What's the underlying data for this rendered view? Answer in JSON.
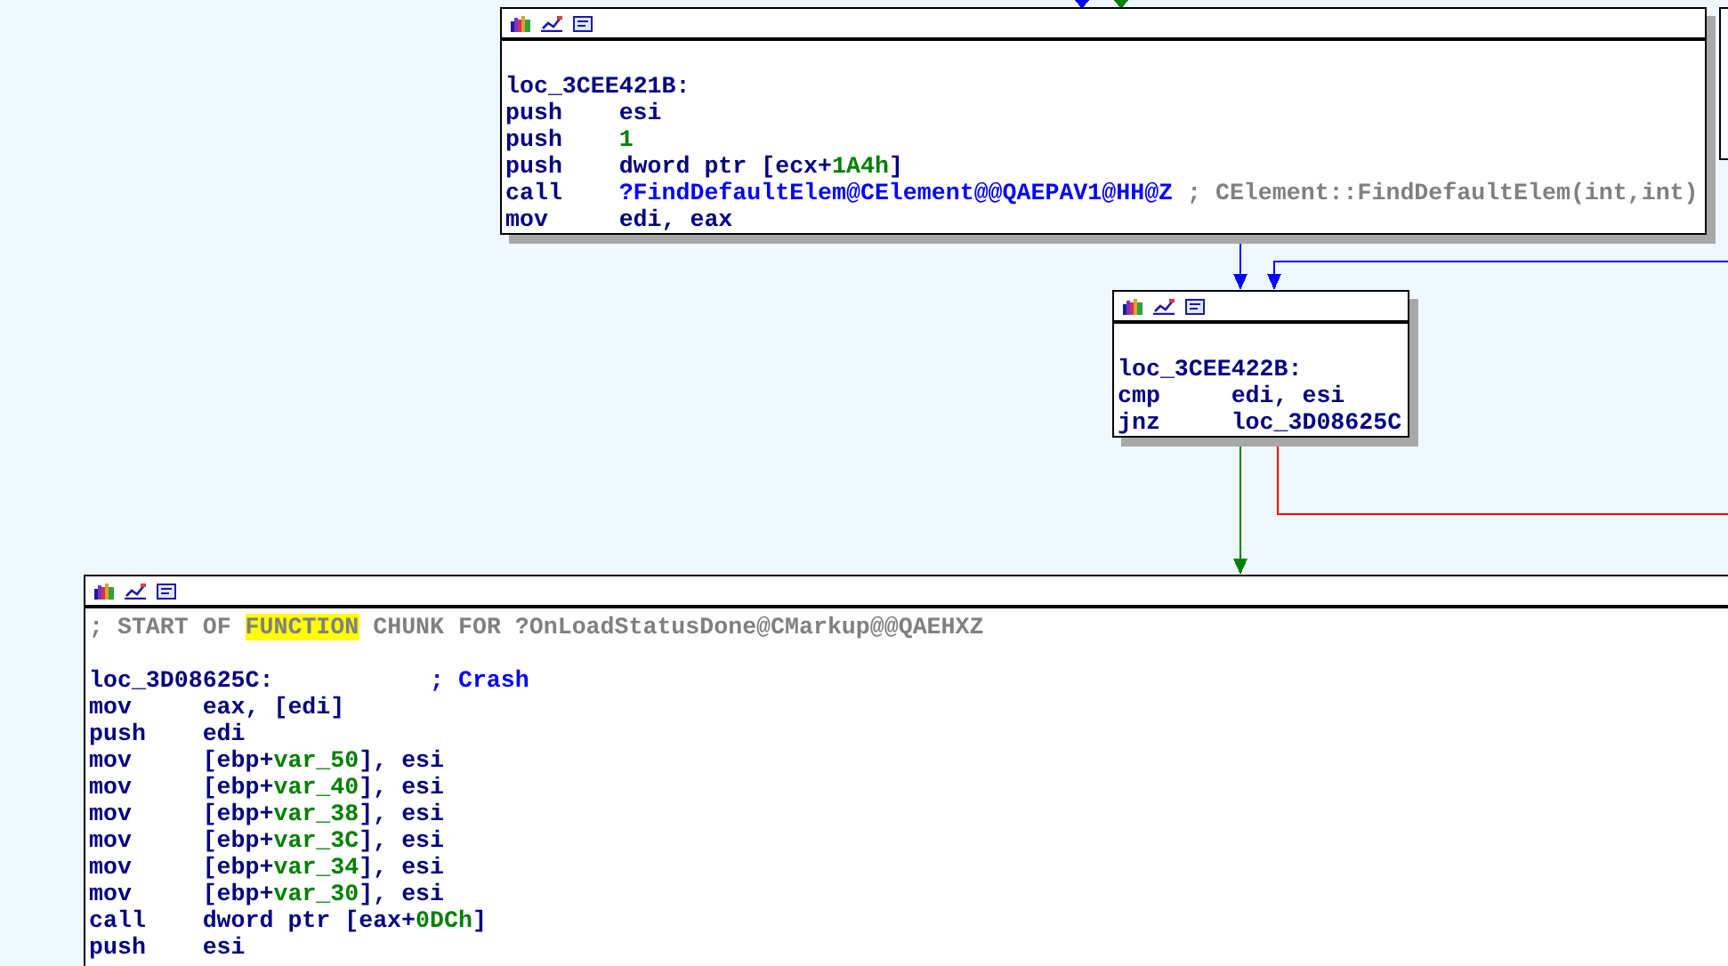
{
  "nodes": [
    {
      "lines": [
        {
          "kind": "blank"
        },
        {
          "kind": "label",
          "text": "loc_3CEE421B:"
        },
        {
          "kind": "instr",
          "mnemonic": "push",
          "operands": [
            {
              "kind": "plain",
              "text": "esi"
            }
          ]
        },
        {
          "kind": "instr",
          "mnemonic": "push",
          "operands": [
            {
              "kind": "num",
              "text": "1"
            }
          ]
        },
        {
          "kind": "instr",
          "mnemonic": "push",
          "operands": [
            {
              "kind": "plain",
              "text": "dword ptr [ecx+"
            },
            {
              "kind": "num",
              "text": "1A4h"
            },
            {
              "kind": "plain",
              "text": "]"
            }
          ]
        },
        {
          "kind": "instr",
          "mnemonic": "call",
          "operands": [
            {
              "kind": "name",
              "text": "?FindDefaultElem@CElement@@QAEPAV1@HH@Z"
            },
            {
              "kind": "comment",
              "text": " ; CElement::FindDefaultElem(int,int)"
            }
          ]
        },
        {
          "kind": "instr",
          "mnemonic": "mov",
          "operands": [
            {
              "kind": "plain",
              "text": "edi, eax"
            }
          ]
        }
      ]
    },
    {
      "lines": [
        {
          "kind": "blank"
        },
        {
          "kind": "label",
          "text": "loc_3CEE422B:"
        },
        {
          "kind": "instr",
          "mnemonic": "cmp",
          "operands": [
            {
              "kind": "plain",
              "text": "edi, esi"
            }
          ]
        },
        {
          "kind": "instr",
          "mnemonic": "jnz",
          "operands": [
            {
              "kind": "plain",
              "text": "loc_3D08625C"
            }
          ]
        }
      ]
    },
    {
      "lines": [
        {
          "kind": "comment",
          "segments": [
            {
              "kind": "comment",
              "text": "; START OF "
            },
            {
              "kind": "highlight",
              "text": "FUNCTION"
            },
            {
              "kind": "comment",
              "text": " CHUNK FOR ?OnLoadStatusDone@CMarkup@@QAEHXZ"
            }
          ]
        },
        {
          "kind": "blank"
        },
        {
          "kind": "label",
          "text": "loc_3D08625C:",
          "comment": "; Crash"
        },
        {
          "kind": "instr",
          "mnemonic": "mov",
          "operands": [
            {
              "kind": "plain",
              "text": "eax, [edi]"
            }
          ]
        },
        {
          "kind": "instr",
          "mnemonic": "push",
          "operands": [
            {
              "kind": "plain",
              "text": "edi"
            }
          ]
        },
        {
          "kind": "instr",
          "mnemonic": "mov",
          "operands": [
            {
              "kind": "plain",
              "text": "[ebp+"
            },
            {
              "kind": "num",
              "text": "var_50"
            },
            {
              "kind": "plain",
              "text": "], esi"
            }
          ]
        },
        {
          "kind": "instr",
          "mnemonic": "mov",
          "operands": [
            {
              "kind": "plain",
              "text": "[ebp+"
            },
            {
              "kind": "num",
              "text": "var_40"
            },
            {
              "kind": "plain",
              "text": "], esi"
            }
          ]
        },
        {
          "kind": "instr",
          "mnemonic": "mov",
          "operands": [
            {
              "kind": "plain",
              "text": "[ebp+"
            },
            {
              "kind": "num",
              "text": "var_38"
            },
            {
              "kind": "plain",
              "text": "], esi"
            }
          ]
        },
        {
          "kind": "instr",
          "mnemonic": "mov",
          "operands": [
            {
              "kind": "plain",
              "text": "[ebp+"
            },
            {
              "kind": "num",
              "text": "var_3C"
            },
            {
              "kind": "plain",
              "text": "], esi"
            }
          ]
        },
        {
          "kind": "instr",
          "mnemonic": "mov",
          "operands": [
            {
              "kind": "plain",
              "text": "[ebp+"
            },
            {
              "kind": "num",
              "text": "var_34"
            },
            {
              "kind": "plain",
              "text": "], esi"
            }
          ]
        },
        {
          "kind": "instr",
          "mnemonic": "mov",
          "operands": [
            {
              "kind": "plain",
              "text": "[ebp+"
            },
            {
              "kind": "num",
              "text": "var_30"
            },
            {
              "kind": "plain",
              "text": "], esi"
            }
          ]
        },
        {
          "kind": "instr",
          "mnemonic": "call",
          "operands": [
            {
              "kind": "plain",
              "text": "dword ptr [eax+"
            },
            {
              "kind": "num",
              "text": "0DCh"
            },
            {
              "kind": "plain",
              "text": "]"
            }
          ]
        },
        {
          "kind": "instr",
          "mnemonic": "push",
          "operands": [
            {
              "kind": "plain",
              "text": "esi"
            }
          ]
        }
      ]
    }
  ],
  "edges": [
    {
      "color": "#0000ff"
    },
    {
      "color": "#008000"
    },
    {
      "color": "#0000ff"
    },
    {
      "color": "#0000ff"
    },
    {
      "color": "#008000"
    },
    {
      "color": "#ff0000"
    }
  ]
}
